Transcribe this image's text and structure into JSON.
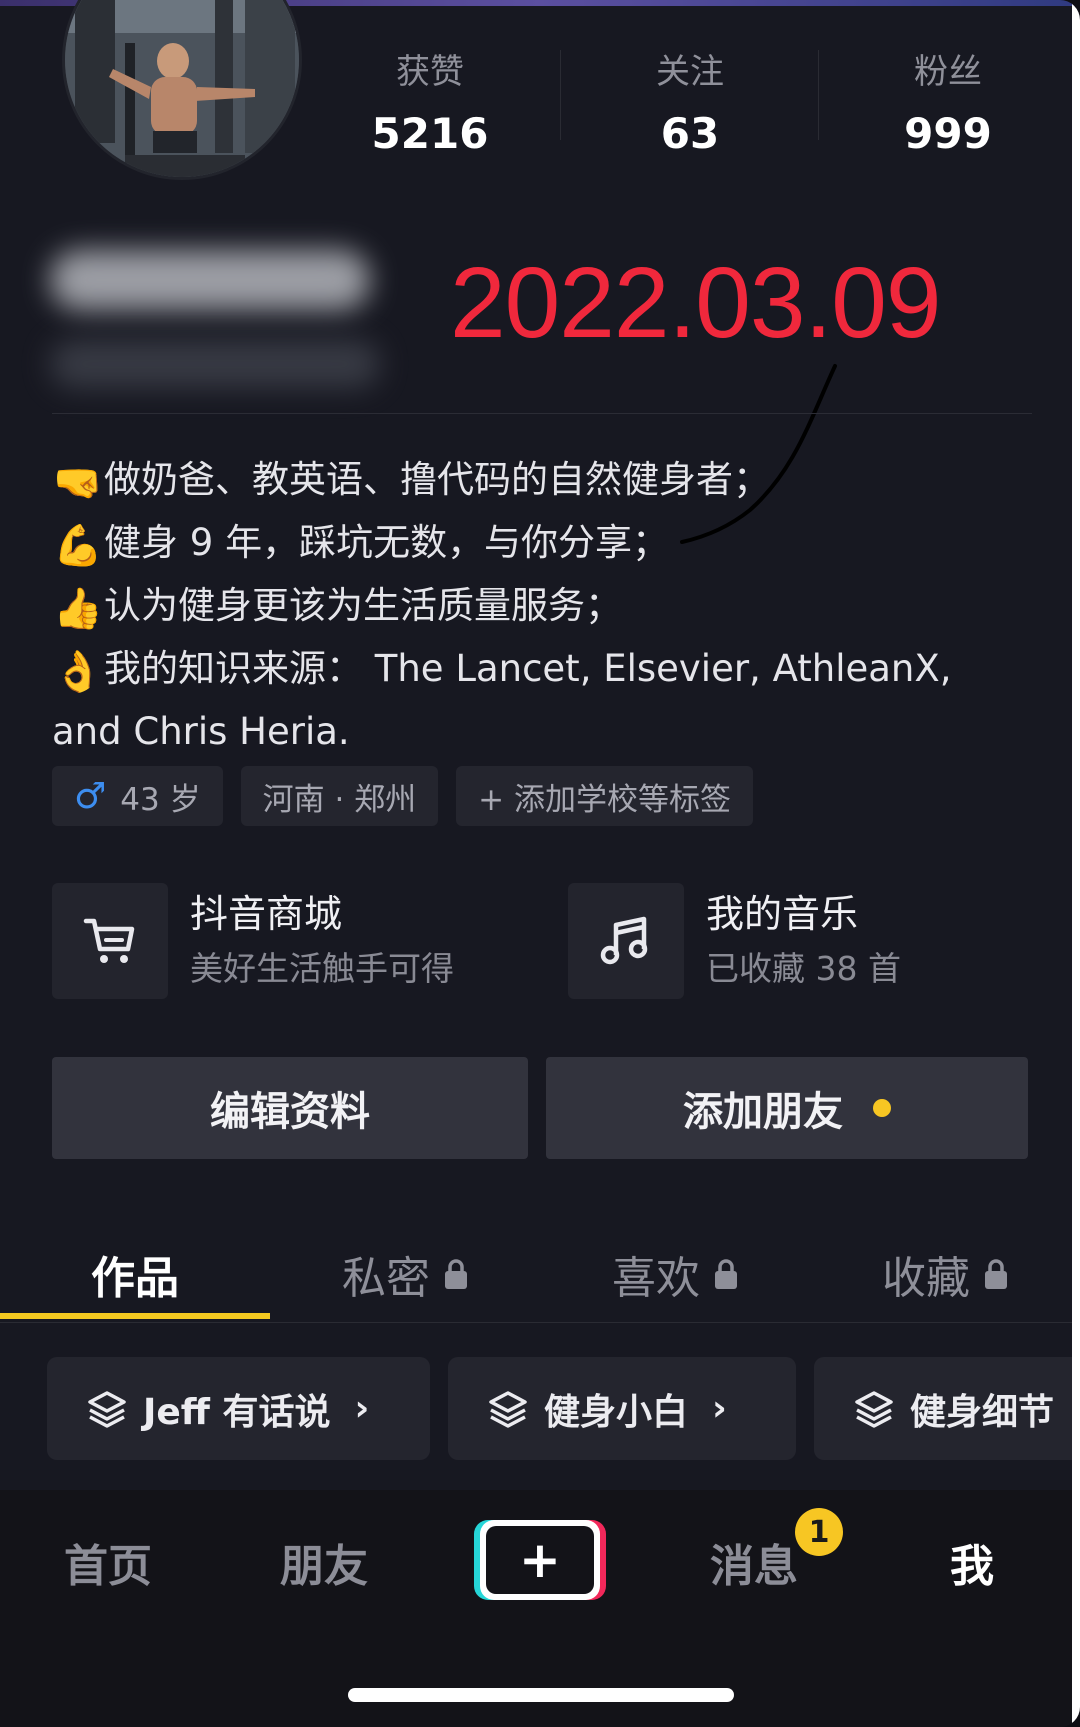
{
  "stats": [
    {
      "label": "获赞",
      "value": "5216"
    },
    {
      "label": "关注",
      "value": "63"
    },
    {
      "label": "粉丝",
      "value": "999"
    }
  ],
  "date_stamp": "2022.03.09",
  "bio": [
    {
      "emoji": "🤜",
      "text": "做奶爸、教英语、撸代码的自然健身者；"
    },
    {
      "emoji": "💪",
      "text": "健身 9 年，踩坑无数，与你分享；"
    },
    {
      "emoji": "👍",
      "text": "认为健身更该为生活质量服务；"
    },
    {
      "emoji": "👌",
      "text": "我的知识来源： The Lancet, Elsevier, AthleanX,"
    },
    {
      "emoji": "",
      "text": "and Chris Heria."
    }
  ],
  "tags": {
    "age": "43 岁",
    "gender_icon": "male-icon",
    "location": "河南 · 郑州",
    "add_label": "+ 添加学校等标签"
  },
  "features": {
    "shop": {
      "title": "抖音商城",
      "subtitle": "美好生活触手可得",
      "icon": "cart-icon"
    },
    "music": {
      "title": "我的音乐",
      "subtitle": "已收藏 38 首",
      "icon": "music-note-icon"
    }
  },
  "buttons": {
    "edit_profile": "编辑资料",
    "add_friend": "添加朋友"
  },
  "tabs": [
    {
      "label": "作品",
      "locked": false,
      "active": true
    },
    {
      "label": "私密",
      "locked": true,
      "active": false
    },
    {
      "label": "喜欢",
      "locked": true,
      "active": false
    },
    {
      "label": "收藏",
      "locked": true,
      "active": false
    }
  ],
  "collections": [
    {
      "label": "Jeff 有话说"
    },
    {
      "label": "健身小白"
    },
    {
      "label": "健身细节"
    }
  ],
  "nav": {
    "home": "首页",
    "friends": "朋友",
    "messages": "消息",
    "messages_badge": "1",
    "me": "我"
  },
  "colors": {
    "accent_yellow": "#f3c820",
    "date_red": "#f0283c",
    "background": "#171821"
  }
}
